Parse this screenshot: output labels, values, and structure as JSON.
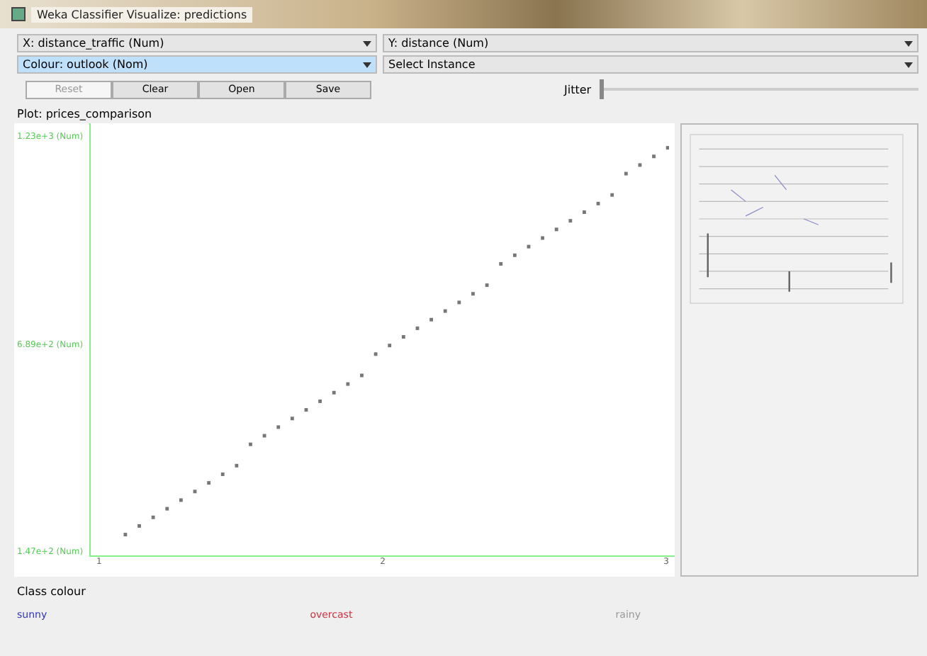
{
  "window": {
    "title": "Weka Classifier Visualize: predictions"
  },
  "selectors": [
    {
      "value": "X: distance_traffic (Num)",
      "highlighted": false
    },
    {
      "value": "Y: distance (Num)",
      "highlighted": false
    },
    {
      "value": "Colour: outlook (Nom)",
      "highlighted": true
    },
    {
      "value": "Select Instance",
      "highlighted": false
    }
  ],
  "buttons": [
    {
      "label": "Reset",
      "disabled": true
    },
    {
      "label": "Clear",
      "disabled": false
    },
    {
      "label": "Open",
      "disabled": false
    },
    {
      "label": "Save",
      "disabled": false
    }
  ],
  "jitter": {
    "label": "Jitter",
    "level": 0
  },
  "plot": {
    "title": "Plot: prices_comparison",
    "y_labels": [
      "1.23e+3 (Num)",
      "6.89e+2 (Num)",
      "1.47e+2 (Num)"
    ],
    "x_labels": [
      "1",
      "2",
      "3"
    ]
  },
  "class_colour": {
    "title": "Class colour",
    "items": [
      {
        "label": "sunny",
        "color": "#3333cc"
      },
      {
        "label": "overcast",
        "color": "#cc3344"
      },
      {
        "label": "rainy",
        "color": "#999999"
      }
    ]
  }
}
